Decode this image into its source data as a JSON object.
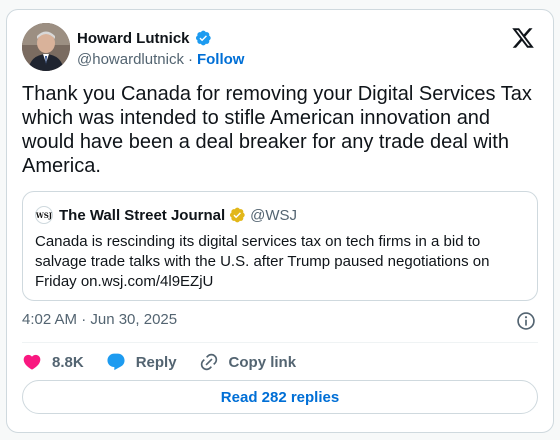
{
  "author": {
    "name": "Howard Lutnick",
    "handle": "@howardlutnick",
    "separator": "·",
    "follow_label": "Follow"
  },
  "tweet": {
    "text": "Thank you Canada for removing your Digital Services Tax which was intended to stifle American innovation and would have been a deal breaker for any trade deal with America.",
    "timestamp": "4:02 AM · Jun 30, 2025"
  },
  "quote": {
    "logo_text": "WSJ",
    "name": "The Wall Street Journal",
    "handle": "@WSJ",
    "text": "Canada is rescinding its digital services tax on tech firms in a bid to salvage trade talks with the U.S. after Trump paused negotiations on Friday on.wsj.com/4l9EZjU"
  },
  "actions": {
    "likes": "8.8K",
    "reply_label": "Reply",
    "copy_label": "Copy link"
  },
  "replies_button": "Read 282 replies",
  "colors": {
    "like": "#f91880",
    "reply": "#1d9bf0",
    "link": "#006fd6",
    "verified_blue": "#1d9bf0",
    "verified_gold": "#e2b719"
  },
  "icons": [
    "verified-badge-icon",
    "x-logo-icon",
    "gold-verified-icon",
    "info-icon",
    "heart-icon",
    "reply-bubble-icon",
    "link-icon"
  ]
}
